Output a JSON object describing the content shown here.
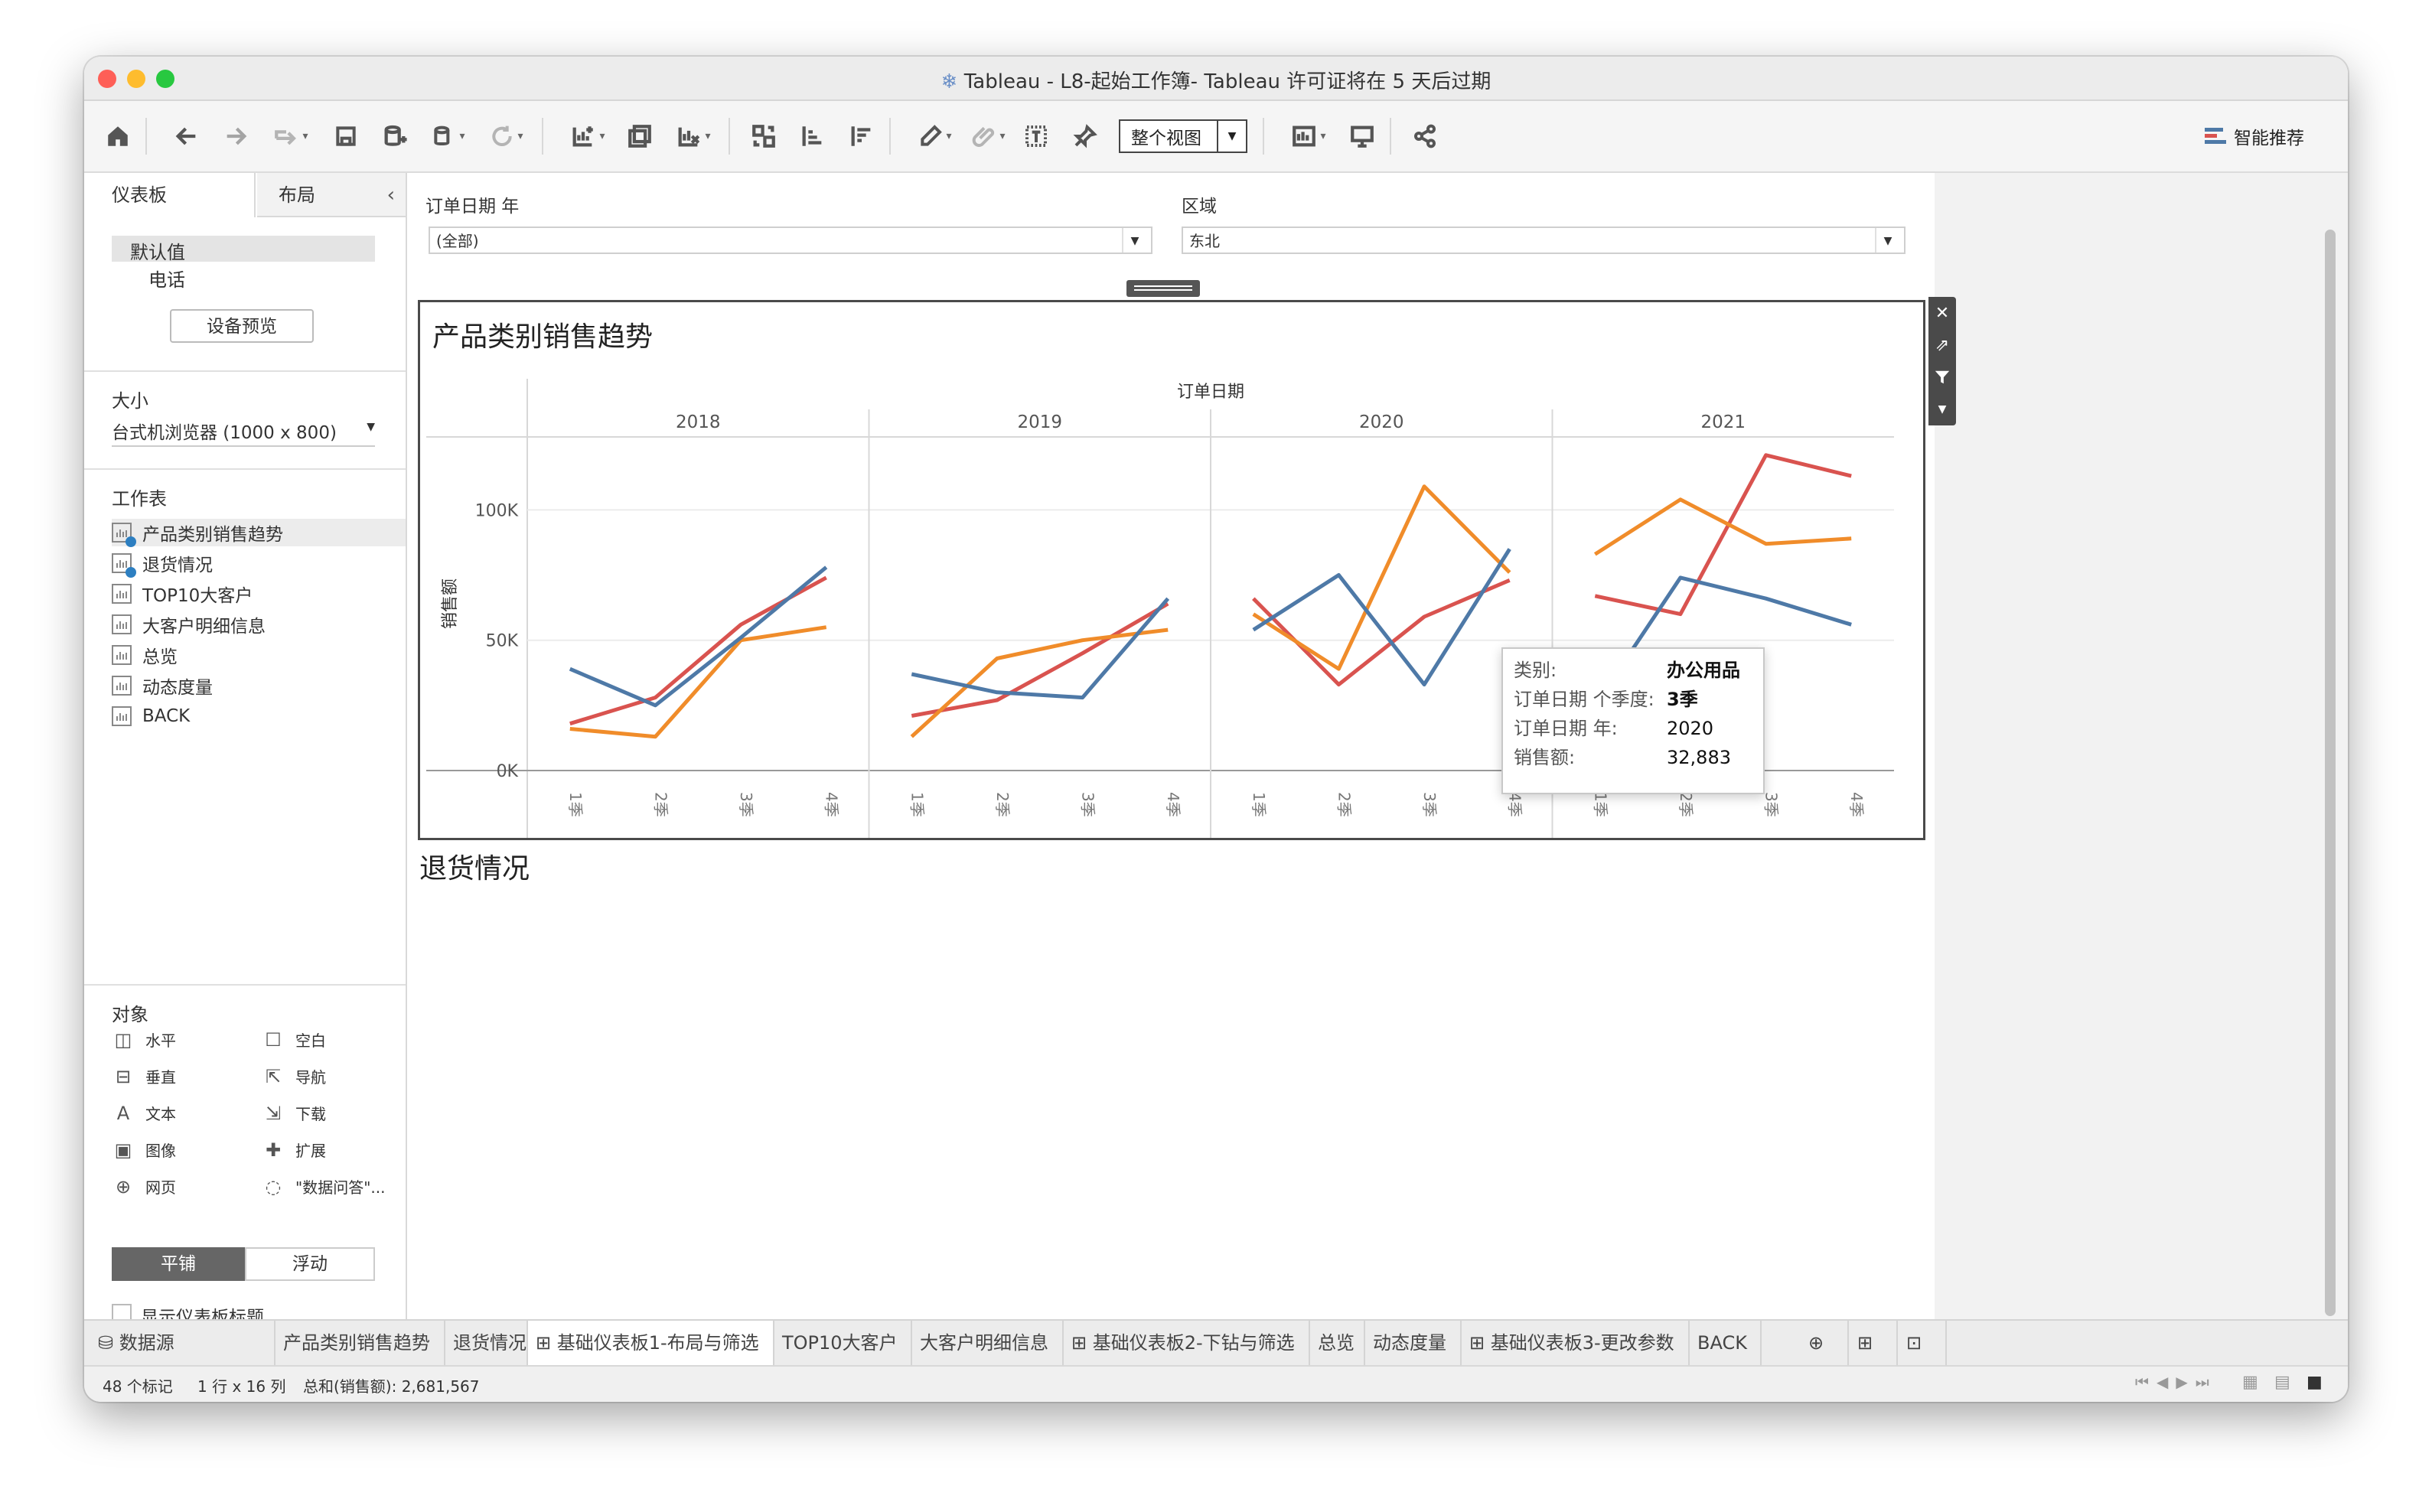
{
  "window": {
    "title": "Tableau - L8-起始工作簿- Tableau 许可证将在 5 天后过期"
  },
  "toolbar": {
    "view_select": "整个视图",
    "smart_recommend": "智能推荐"
  },
  "left_panel": {
    "tab_dashboard": "仪表板",
    "tab_layout": "布局",
    "devices": [
      "默认值",
      "电话"
    ],
    "device_preview_button": "设备预览",
    "size_label": "大小",
    "size_value": "台式机浏览器 (1000 x 800)",
    "sheets_label": "工作表",
    "sheets": [
      {
        "label": "产品类别销售趋势",
        "used": true
      },
      {
        "label": "退货情况",
        "used": true
      },
      {
        "label": "TOP10大客户",
        "used": false
      },
      {
        "label": "大客户明细信息",
        "used": false
      },
      {
        "label": "总览",
        "used": false
      },
      {
        "label": "动态度量",
        "used": false
      },
      {
        "label": "BACK",
        "used": false
      }
    ],
    "objects_label": "对象",
    "objects": [
      {
        "label": "水平",
        "icon": "horizontal-icon"
      },
      {
        "label": "空白",
        "icon": "blank-icon"
      },
      {
        "label": "垂直",
        "icon": "vertical-icon"
      },
      {
        "label": "导航",
        "icon": "navigation-icon"
      },
      {
        "label": "文本",
        "icon": "text-icon"
      },
      {
        "label": "下载",
        "icon": "download-icon"
      },
      {
        "label": "图像",
        "icon": "image-icon"
      },
      {
        "label": "扩展",
        "icon": "extension-icon"
      },
      {
        "label": "网页",
        "icon": "web-icon"
      },
      {
        "label": "\"数据问答\"...",
        "icon": "ask-data-icon"
      }
    ],
    "tiled_button": "平铺",
    "floating_button": "浮动",
    "show_title_label": "显示仪表板标题"
  },
  "filters": {
    "year_label": "订单日期 年",
    "year_value": "(全部)",
    "region_label": "区域",
    "region_value": "东北"
  },
  "chart_title": "产品类别销售趋势",
  "second_title": "退货情况",
  "tooltip": {
    "rows": [
      {
        "label": "类别:",
        "value": "办公用品"
      },
      {
        "label": "订单日期 个季度:",
        "value": "3季"
      },
      {
        "label": "订单日期 年:",
        "value": "2020"
      },
      {
        "label": "销售额:",
        "value": "32,883"
      }
    ]
  },
  "chart_data": {
    "type": "line",
    "title": "产品类别销售趋势",
    "xlabel": "订单日期",
    "ylabel": "销售额",
    "years": [
      "2018",
      "2019",
      "2020",
      "2021"
    ],
    "quarter_labels": [
      "1季",
      "2季",
      "3季",
      "4季"
    ],
    "yticks": [
      "0K",
      "50K",
      "100K"
    ],
    "ylim": [
      0,
      128000
    ],
    "grid": true,
    "colors": {
      "red": "#d9534f",
      "orange": "#f08c2a",
      "blue": "#4e79a7"
    },
    "series": [
      {
        "color": "#d9534f",
        "values": [
          18000,
          28000,
          56000,
          74000,
          21000,
          27000,
          45000,
          64000,
          66000,
          33000,
          59000,
          73000,
          67000,
          60000,
          121000,
          113000
        ]
      },
      {
        "color": "#f08c2a",
        "values": [
          16000,
          13000,
          50000,
          55000,
          13000,
          43000,
          50000,
          54000,
          60000,
          39000,
          109000,
          76000,
          83000,
          104000,
          87000,
          89000
        ]
      },
      {
        "color": "#4e79a7",
        "values": [
          39000,
          25000,
          51000,
          78000,
          37000,
          30000,
          28000,
          66000,
          54000,
          75000,
          33000,
          85000,
          25000,
          74000,
          66000,
          56000
        ]
      }
    ]
  },
  "tabs": {
    "datasource": "数据源",
    "items": [
      {
        "label": "产品类别销售趋势",
        "kind": "sheet"
      },
      {
        "label": "退货情况",
        "kind": "sheet"
      },
      {
        "label": "基础仪表板1-布局与筛选",
        "kind": "dashboard"
      },
      {
        "label": "TOP10大客户",
        "kind": "sheet"
      },
      {
        "label": "大客户明细信息",
        "kind": "sheet"
      },
      {
        "label": "基础仪表板2-下钻与筛选",
        "kind": "dashboard"
      },
      {
        "label": "总览",
        "kind": "sheet"
      },
      {
        "label": "动态度量",
        "kind": "sheet"
      },
      {
        "label": "基础仪表板3-更改参数",
        "kind": "dashboard"
      },
      {
        "label": "BACK",
        "kind": "sheet"
      }
    ]
  },
  "status": {
    "marks": "48 个标记",
    "dims": "1 行 x 16 列",
    "sum": "总和(销售额): 2,681,567"
  }
}
